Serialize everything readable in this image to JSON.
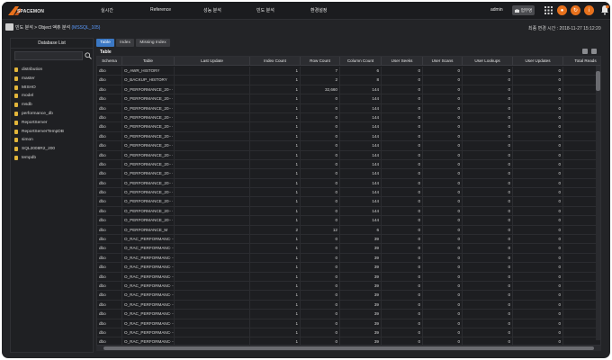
{
  "app": {
    "logo_text": "SPACEMON"
  },
  "nav": {
    "items": [
      "실시간",
      "Reference",
      "성능 분석",
      "빈도 분석",
      "환경설정"
    ]
  },
  "header": {
    "user": "admin",
    "work_button": "업무명"
  },
  "breadcrumb": {
    "path": "빈도 분석 > Object 액츄 분석",
    "instance": "(MSSQL_105)"
  },
  "status": {
    "last_change": "최종 변경 시간 : 2018-11-27 15:12:20"
  },
  "sidebar": {
    "title": "Database List",
    "search_placeholder": "",
    "databases": [
      "distribution",
      "master",
      "MISHO",
      "model",
      "msdb",
      "performance_db",
      "ReportServer",
      "ReportServerTempDB",
      "simon",
      "SQL2008R2_200",
      "tempdb"
    ]
  },
  "tabs": [
    "Table",
    "Index",
    "Missing Index"
  ],
  "table": {
    "title": "Table",
    "columns": [
      "Schema",
      "Table",
      "Last Update",
      "Index Count",
      "Row Count",
      "Column Count",
      "User Seeks",
      "User Scans",
      "User Lookups",
      "User Updates",
      "Total Reads"
    ],
    "rows": [
      [
        "dbo",
        "O_AWR_HISTORY",
        "",
        "1",
        "7",
        "6",
        "0",
        "0",
        "0",
        "0",
        ""
      ],
      [
        "dbo",
        "O_BACKUP_HISTORY",
        "",
        "1",
        "2",
        "8",
        "0",
        "0",
        "0",
        "0",
        ""
      ],
      [
        "dbo",
        "O_PERFORMANCE_20···",
        "",
        "1",
        "32,660",
        "144",
        "0",
        "0",
        "0",
        "0",
        ""
      ],
      [
        "dbo",
        "O_PERFORMANCE_20···",
        "",
        "1",
        "0",
        "144",
        "0",
        "0",
        "0",
        "0",
        ""
      ],
      [
        "dbo",
        "O_PERFORMANCE_20···",
        "",
        "1",
        "0",
        "144",
        "0",
        "0",
        "0",
        "0",
        ""
      ],
      [
        "dbo",
        "O_PERFORMANCE_20···",
        "",
        "1",
        "0",
        "144",
        "0",
        "0",
        "0",
        "0",
        ""
      ],
      [
        "dbo",
        "O_PERFORMANCE_20···",
        "",
        "1",
        "0",
        "144",
        "0",
        "0",
        "0",
        "0",
        ""
      ],
      [
        "dbo",
        "O_PERFORMANCE_20···",
        "",
        "1",
        "0",
        "144",
        "0",
        "0",
        "0",
        "0",
        ""
      ],
      [
        "dbo",
        "O_PERFORMANCE_20···",
        "",
        "1",
        "0",
        "144",
        "0",
        "0",
        "0",
        "0",
        ""
      ],
      [
        "dbo",
        "O_PERFORMANCE_20···",
        "",
        "1",
        "0",
        "144",
        "0",
        "0",
        "0",
        "0",
        ""
      ],
      [
        "dbo",
        "O_PERFORMANCE_20···",
        "",
        "1",
        "0",
        "144",
        "0",
        "0",
        "0",
        "0",
        ""
      ],
      [
        "dbo",
        "O_PERFORMANCE_20···",
        "",
        "1",
        "0",
        "144",
        "0",
        "0",
        "0",
        "0",
        ""
      ],
      [
        "dbo",
        "O_PERFORMANCE_20···",
        "",
        "1",
        "0",
        "144",
        "0",
        "0",
        "0",
        "0",
        ""
      ],
      [
        "dbo",
        "O_PERFORMANCE_20···",
        "",
        "1",
        "0",
        "144",
        "0",
        "0",
        "0",
        "0",
        ""
      ],
      [
        "dbo",
        "O_PERFORMANCE_20···",
        "",
        "1",
        "0",
        "144",
        "0",
        "0",
        "0",
        "0",
        ""
      ],
      [
        "dbo",
        "O_PERFORMANCE_20···",
        "",
        "1",
        "0",
        "144",
        "0",
        "0",
        "0",
        "0",
        ""
      ],
      [
        "dbo",
        "O_PERFORMANCE_20···",
        "",
        "1",
        "0",
        "144",
        "0",
        "0",
        "0",
        "0",
        ""
      ],
      [
        "dbo",
        "O_PERFORMANCE_M",
        "",
        "2",
        "12",
        "6",
        "0",
        "0",
        "0",
        "0",
        ""
      ],
      [
        "dbo",
        "O_RAC_PERFORMANC···",
        "",
        "1",
        "0",
        "39",
        "0",
        "0",
        "0",
        "0",
        ""
      ],
      [
        "dbo",
        "O_RAC_PERFORMANC···",
        "",
        "1",
        "0",
        "39",
        "0",
        "0",
        "0",
        "0",
        ""
      ],
      [
        "dbo",
        "O_RAC_PERFORMANC···",
        "",
        "1",
        "0",
        "39",
        "0",
        "0",
        "0",
        "0",
        ""
      ],
      [
        "dbo",
        "O_RAC_PERFORMANC···",
        "",
        "1",
        "0",
        "39",
        "0",
        "0",
        "0",
        "0",
        ""
      ],
      [
        "dbo",
        "O_RAC_PERFORMANC···",
        "",
        "1",
        "0",
        "39",
        "0",
        "0",
        "0",
        "0",
        ""
      ],
      [
        "dbo",
        "O_RAC_PERFORMANC···",
        "",
        "1",
        "0",
        "39",
        "0",
        "0",
        "0",
        "0",
        ""
      ],
      [
        "dbo",
        "O_RAC_PERFORMANC···",
        "",
        "1",
        "0",
        "39",
        "0",
        "0",
        "0",
        "0",
        ""
      ],
      [
        "dbo",
        "O_RAC_PERFORMANC···",
        "",
        "1",
        "0",
        "39",
        "0",
        "0",
        "0",
        "0",
        ""
      ],
      [
        "dbo",
        "O_RAC_PERFORMANC···",
        "",
        "1",
        "0",
        "39",
        "0",
        "0",
        "0",
        "0",
        ""
      ],
      [
        "dbo",
        "O_RAC_PERFORMANC···",
        "",
        "1",
        "0",
        "39",
        "0",
        "0",
        "0",
        "0",
        ""
      ],
      [
        "dbo",
        "O_RAC_PERFORMANC···",
        "",
        "1",
        "0",
        "39",
        "0",
        "0",
        "0",
        "0",
        ""
      ],
      [
        "dbo",
        "O_RAC_PERFORMANC···",
        "",
        "1",
        "0",
        "39",
        "0",
        "0",
        "0",
        "0",
        ""
      ],
      [
        "dbo",
        "O_RAC_PERFORMANC···",
        "",
        "1",
        "0",
        "39",
        "0",
        "0",
        "0",
        "0",
        ""
      ]
    ]
  },
  "colors": {
    "accent": "#3b78c4",
    "brand": "#e8711c",
    "background": "#232427",
    "link": "#5b9bff"
  }
}
